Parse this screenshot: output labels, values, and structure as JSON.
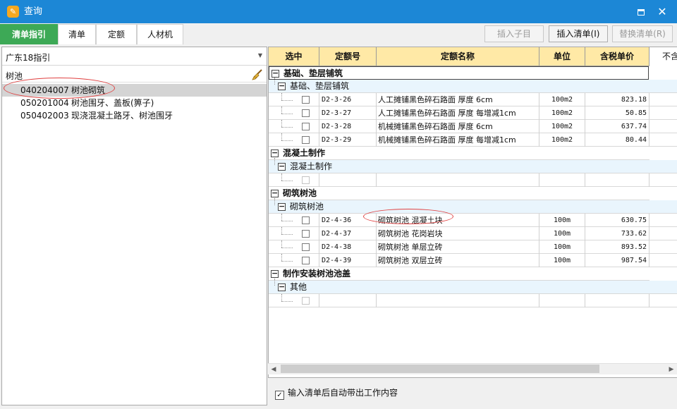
{
  "window": {
    "title": "查询",
    "app_icon": "app-logo-icon",
    "maximize_icon": "maximize-icon",
    "close_icon": "close-icon",
    "close_glyph": "✕"
  },
  "tabs": [
    "清单指引",
    "清单",
    "定额",
    "人材机"
  ],
  "toolbar": {
    "insert_child": "插入子目",
    "insert_list": "插入清单(I)",
    "replace_list": "替换清单(R)"
  },
  "left": {
    "guide_select": "广东18指引",
    "search_value": "树池",
    "items": [
      {
        "code": "040204007",
        "name": "树池砌筑"
      },
      {
        "code": "050201004",
        "name": "树池围牙、盖板(箅子)"
      },
      {
        "code": "050402003",
        "name": "现浇混凝土路牙、树池围牙"
      }
    ]
  },
  "table": {
    "columns": [
      "选中",
      "定额号",
      "定额名称",
      "单位",
      "含税单价",
      "不含"
    ],
    "groups": [
      {
        "title": "基础、垫层铺筑",
        "subtitle": "基础、垫层铺筑",
        "rows": [
          {
            "code": "D2-3-26",
            "name": "人工摊铺黑色碎石路面 厚度 6cm",
            "unit": "100m2",
            "price": "823.18"
          },
          {
            "code": "D2-3-27",
            "name": "人工摊铺黑色碎石路面 厚度 每增减1cm",
            "unit": "100m2",
            "price": "50.85"
          },
          {
            "code": "D2-3-28",
            "name": "机械摊铺黑色碎石路面 厚度 6cm",
            "unit": "100m2",
            "price": "637.74"
          },
          {
            "code": "D2-3-29",
            "name": "机械摊铺黑色碎石路面 厚度 每增减1cm",
            "unit": "100m2",
            "price": "80.44"
          }
        ]
      },
      {
        "title": "混凝土制作",
        "subtitle": "混凝土制作",
        "rows": [
          {
            "code": "",
            "name": "",
            "unit": "",
            "price": ""
          }
        ]
      },
      {
        "title": "砌筑树池",
        "subtitle": "砌筑树池",
        "rows": [
          {
            "code": "D2-4-36",
            "name": "砌筑树池 混凝土块",
            "unit": "100m",
            "price": "630.75"
          },
          {
            "code": "D2-4-37",
            "name": "砌筑树池 花岗岩块",
            "unit": "100m",
            "price": "733.62"
          },
          {
            "code": "D2-4-38",
            "name": "砌筑树池 单层立砖",
            "unit": "100m",
            "price": "893.52"
          },
          {
            "code": "D2-4-39",
            "name": "砌筑树池 双层立砖",
            "unit": "100m",
            "price": "987.54"
          }
        ]
      },
      {
        "title": "制作安装树池池盖",
        "subtitle": "其他",
        "rows": [
          {
            "code": "",
            "name": "",
            "unit": "",
            "price": ""
          }
        ]
      }
    ]
  },
  "footer": {
    "auto_content_label": "输入清单后自动带出工作内容",
    "auto_content_checked": true
  },
  "colors": {
    "titlebar": "#1c87d6",
    "active_tab": "#3da956",
    "header_bg": "#ffe9a6",
    "annotation": "#e04040"
  }
}
